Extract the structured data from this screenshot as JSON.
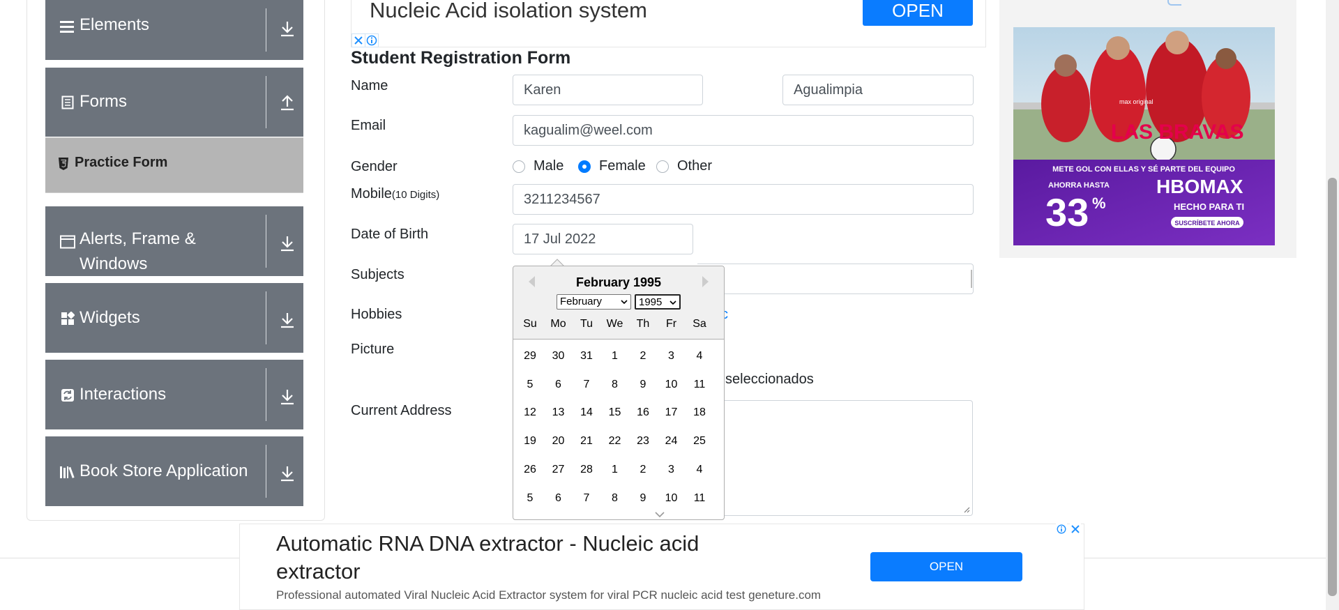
{
  "sidebar": {
    "groups": [
      {
        "label": "Elements",
        "icon": "hamburger-icon",
        "arrow": "download-arrow-icon"
      },
      {
        "label": "Forms",
        "icon": "document-icon",
        "arrow": "upload-arrow-icon"
      },
      {
        "label": "Alerts, Frame & Windows",
        "icon": "window-icon",
        "arrow": "download-arrow-icon"
      },
      {
        "label": "Widgets",
        "icon": "widgets-icon",
        "arrow": "download-arrow-icon"
      },
      {
        "label": "Interactions",
        "icon": "interactions-icon",
        "arrow": "download-arrow-icon"
      },
      {
        "label": "Book Store Application",
        "icon": "books-icon",
        "arrow": "download-arrow-icon"
      }
    ],
    "active_item": "Practice Form"
  },
  "top_ad": {
    "title": "Nucleic Acid isolation system",
    "button": "OPEN"
  },
  "form": {
    "title": "Student Registration Form",
    "labels": {
      "name": "Name",
      "email": "Email",
      "gender": "Gender",
      "mobile": "Mobile",
      "mobile_hint": "(10 Digits)",
      "dob": "Date of Birth",
      "subjects": "Subjects",
      "hobbies": "Hobbies",
      "picture": "Picture",
      "address": "Current Address"
    },
    "first_name": "Karen",
    "last_name": "Agualimpia",
    "email": "kagualim@weel.com",
    "gender_options": [
      "Male",
      "Female",
      "Other"
    ],
    "gender_selected": "Female",
    "mobile": "3211234567",
    "dob": "17 Jul 2022",
    "hobbies_partial": "c",
    "picture_partial": "seleccionados"
  },
  "datepicker": {
    "title": "February 1995",
    "month_select": "February",
    "year_select": "1995",
    "weekdays": [
      "Su",
      "Mo",
      "Tu",
      "We",
      "Th",
      "Fr",
      "Sa"
    ],
    "weeks": [
      [
        "29",
        "30",
        "31",
        "1",
        "2",
        "3",
        "4"
      ],
      [
        "5",
        "6",
        "7",
        "8",
        "9",
        "10",
        "11"
      ],
      [
        "12",
        "13",
        "14",
        "15",
        "16",
        "17",
        "18"
      ],
      [
        "19",
        "20",
        "21",
        "22",
        "23",
        "24",
        "25"
      ],
      [
        "26",
        "27",
        "28",
        "1",
        "2",
        "3",
        "4"
      ],
      [
        "5",
        "6",
        "7",
        "8",
        "9",
        "10",
        "11"
      ]
    ]
  },
  "right_ad": {
    "brand_top": "max original",
    "show_title": "LAS BRAVAS",
    "tagline": "METE GOL CON ELLAS Y SÉ PARTE DEL EQUIPO",
    "discount_prefix": "AHORRA HASTA",
    "discount": "33",
    "discount_unit": "%",
    "brand": "HBOMAX",
    "brand_sub": "HECHO PARA TI",
    "cta": "SUSCRÍBETE AHORA"
  },
  "bottom_ad": {
    "title": "Automatic RNA DNA extractor - Nucleic acid extractor",
    "subtitle": "Professional automated Viral Nucleic Acid Extractor system for viral PCR nucleic acid test geneture.com",
    "button": "OPEN"
  },
  "colors": {
    "sidebar": "#6c737c",
    "active": "#b5b5b5",
    "primary": "#007bff",
    "ad_button": "#0a7cff"
  }
}
